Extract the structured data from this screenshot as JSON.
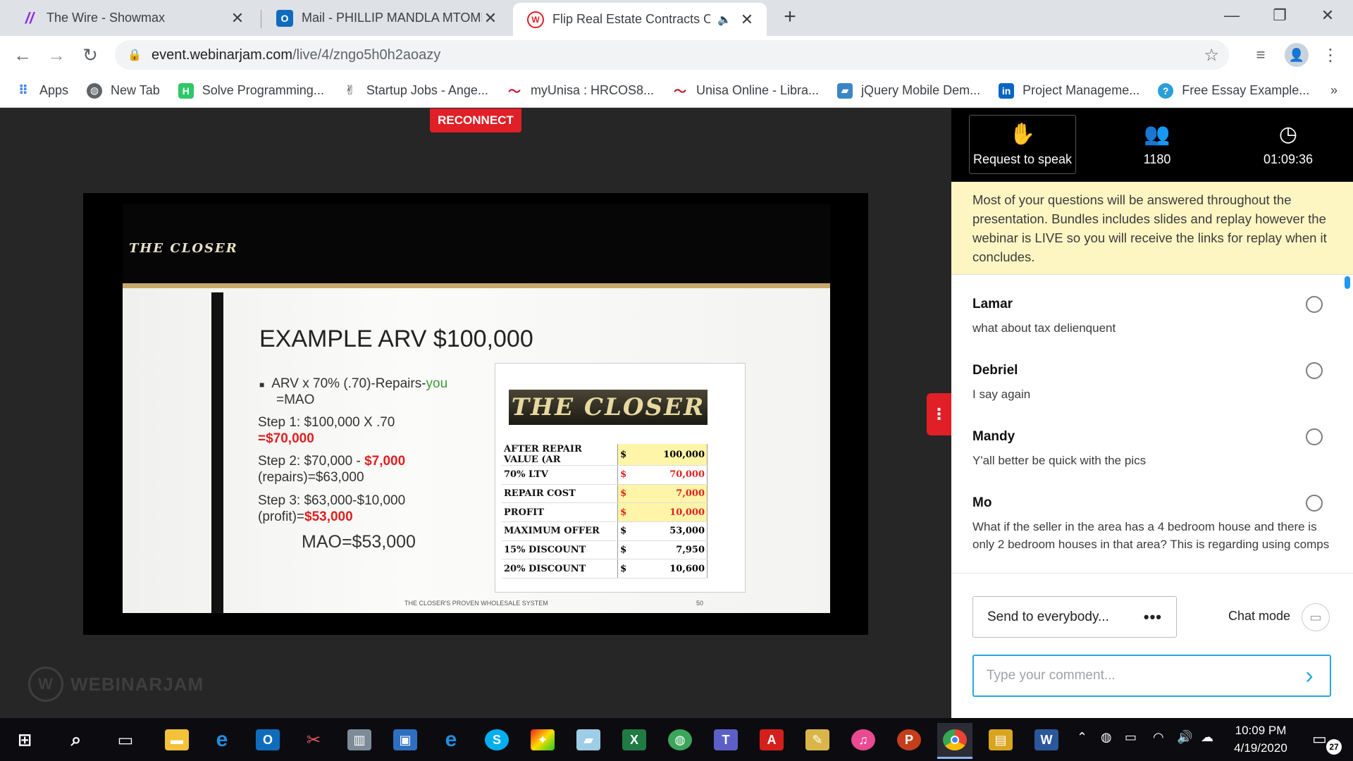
{
  "browser": {
    "tabs": [
      {
        "title": "The Wire - Showmax",
        "icon": "showmax-icon",
        "color": "#8e2de2"
      },
      {
        "title": "Mail - PHILLIP MANDLA MTOMBE",
        "icon": "outlook-icon",
        "color": "#0f6cbd"
      },
      {
        "title": "Flip Real Estate Contracts Of",
        "icon": "webinarjam-icon",
        "color": "#e01f26"
      }
    ],
    "new_tab": "+",
    "url_host": "event.webinarjam.com",
    "url_path": "/live/4/zngo5h0h2aoazy",
    "bookmarks": [
      {
        "label": "Apps",
        "icon": "apps-grid-icon"
      },
      {
        "label": "New Tab",
        "icon": "globe-icon"
      },
      {
        "label": "Solve Programming...",
        "icon": "hackerrank-icon"
      },
      {
        "label": "Startup Jobs - Ange...",
        "icon": "angellist-icon"
      },
      {
        "label": "myUnisa : HRCOS8...",
        "icon": "unisa-icon"
      },
      {
        "label": "Unisa Online - Libra...",
        "icon": "unisa-icon"
      },
      {
        "label": "jQuery Mobile Dem...",
        "icon": "jquery-icon"
      },
      {
        "label": "Project Manageme...",
        "icon": "linkedin-icon"
      },
      {
        "label": "Free Essay Example...",
        "icon": "essay-icon"
      }
    ],
    "bookmarks_more": "»"
  },
  "webinar": {
    "reconnect_label": "RECONNECT",
    "brand": "WEBINARJAM",
    "slide": {
      "logo": "THE CLOSER",
      "title": "EXAMPLE ARV $100,000",
      "bullet_main": "ARV x 70% (.70)-Repairs-",
      "bullet_you": "you",
      "bullet_line2": "=MAO",
      "step1_a": "Step 1: $100,000 X .70",
      "step1_b": "=$70,000",
      "step2_a": "Step 2: $70,000 - ",
      "step2_red": "$7,000",
      "step2_b": "(repairs)=$63,000",
      "step3_a": "Step 3: $63,000-$10,000",
      "step3_b": "(profit)=",
      "step3_red": "$53,000",
      "mao": "MAO=$53,000",
      "sheet_logo": "THE CLOSER",
      "sheet_rows": [
        {
          "label": "AFTER REPAIR VALUE (AR",
          "cur": "$",
          "value": "100,000",
          "red": false,
          "hl": true
        },
        {
          "label": "70% LTV",
          "cur": "$",
          "value": "70,000",
          "red": true,
          "hl": false
        },
        {
          "label": "REPAIR COST",
          "cur": "$",
          "value": "7,000",
          "red": true,
          "hl": true
        },
        {
          "label": "PROFIT",
          "cur": "$",
          "value": "10,000",
          "red": true,
          "hl": true
        },
        {
          "label": "MAXIMUM OFFER",
          "cur": "$",
          "value": "53,000",
          "red": false,
          "hl": false
        },
        {
          "label": "15% DISCOUNT",
          "cur": "$",
          "value": "7,950",
          "red": false,
          "hl": false
        },
        {
          "label": "20% DISCOUNT",
          "cur": "$",
          "value": "10,600",
          "red": false,
          "hl": false
        }
      ],
      "footer": "THE CLOSER'S PROVEN WHOLESALE SYSTEM",
      "page": "50"
    }
  },
  "sidebar": {
    "request_label": "Request to speak",
    "attendees": "1180",
    "elapsed": "01:09:36",
    "notice": "Most of your questions will be answered throughout the presentation. Bundles includes slides and replay however the webinar is LIVE so you will receive the links for replay when it concludes.",
    "messages": [
      {
        "name": "Lamar",
        "text": "what about tax delienquent"
      },
      {
        "name": "Debriel",
        "text": "I say again"
      },
      {
        "name": "Mandy",
        "text": "Y'all better be quick with the pics"
      },
      {
        "name": "Mo",
        "text": "What if the seller in the area has a 4 bedroom house and there is only 2 bedroom houses in that area? This is regarding using comps"
      }
    ],
    "send_to": "Send to everybody...",
    "send_to_more": "•••",
    "chat_mode": "Chat mode",
    "comment_placeholder": "Type your comment..."
  },
  "taskbar": {
    "time": "10:09 PM",
    "date": "4/19/2020",
    "notifications": "27"
  }
}
